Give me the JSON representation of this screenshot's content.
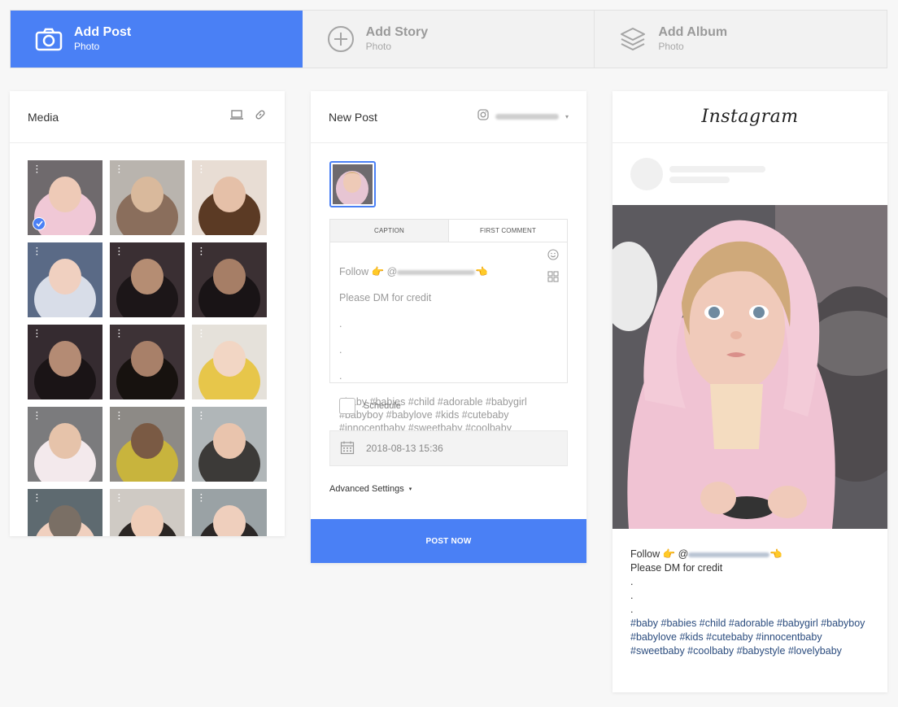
{
  "tabs": [
    {
      "title": "Add Post",
      "subtitle": "Photo",
      "icon": "camera-icon",
      "active": true
    },
    {
      "title": "Add Story",
      "subtitle": "Photo",
      "icon": "plus-circle-icon",
      "active": false
    },
    {
      "title": "Add Album",
      "subtitle": "Photo",
      "icon": "layers-icon",
      "active": false
    }
  ],
  "media": {
    "title": "Media",
    "tools": [
      "laptop-icon",
      "link-icon"
    ],
    "thumbnail_count": 18,
    "selected_index": 0
  },
  "new_post": {
    "title": "New Post",
    "account_icon": "instagram-icon",
    "caption_tabs": [
      "Caption",
      "First Comment"
    ],
    "caption": {
      "line1": "Follow 👉 @",
      "line1_end": "👈",
      "line2": "Please DM for credit",
      "dots": [
        ".",
        ".",
        "."
      ],
      "hashtags": "#baby #babies #child #adorable #babygirl #babyboy #babylove #kids #cutebaby #innocentbaby #sweetbaby #coolbaby #babystyle #lovelybaby"
    },
    "schedule_label": "Schedule",
    "schedule_checked": false,
    "datetime": "2018-08-13 15:36",
    "advanced_settings": "Advanced Settings",
    "post_button": "POST NOW"
  },
  "preview": {
    "logo": "Instagram",
    "caption": {
      "line1": "Follow 👉 @",
      "line1_end": "👈",
      "line2": "Please DM for credit",
      "dots": [
        ".",
        ".",
        "."
      ],
      "hashtags": "#baby #babies #child #adorable #babygirl #babyboy #babylove #kids #cutebaby #innocentbaby #sweetbaby #coolbaby #babystyle #lovelybaby"
    }
  },
  "colors": {
    "accent": "#4a80f5",
    "hashtag": "#2b4c7e",
    "placeholder_text": "#9a9a9a"
  }
}
